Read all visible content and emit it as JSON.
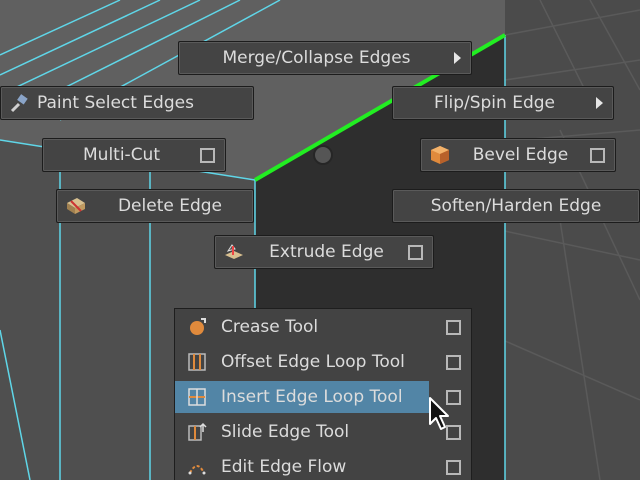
{
  "colors": {
    "viewport_bg": "#4a4a4a",
    "wire": "#5fd6e8",
    "selected_edge": "#22ee22",
    "highlight": "#5285a6"
  },
  "marking_menu": {
    "merge_collapse": {
      "label": "Merge/Collapse Edges",
      "submenu_arrow": true
    },
    "paint_select": {
      "label": "Paint Select Edges",
      "icon": "paint-select-icon"
    },
    "flip_spin": {
      "label": "Flip/Spin Edge",
      "submenu_arrow": true
    },
    "multi_cut": {
      "label": "Multi-Cut",
      "option_box": true
    },
    "bevel": {
      "label": "Bevel Edge",
      "icon": "bevel-icon",
      "option_box": true
    },
    "delete_edge": {
      "label": "Delete Edge",
      "icon": "delete-edge-icon"
    },
    "soften_harden": {
      "label": "Soften/Harden Edge"
    },
    "extrude": {
      "label": "Extrude Edge",
      "icon": "extrude-icon",
      "option_box": true
    }
  },
  "submenu": {
    "items": [
      {
        "label": "Crease Tool",
        "icon": "crease-icon"
      },
      {
        "label": "Offset Edge Loop Tool",
        "icon": "offset-edge-loop-icon"
      },
      {
        "label": "Insert Edge Loop Tool",
        "icon": "insert-edge-loop-icon",
        "highlighted": true
      },
      {
        "label": "Slide Edge Tool",
        "icon": "slide-edge-icon"
      },
      {
        "label": "Edit Edge Flow",
        "icon": "edit-edge-flow-icon"
      }
    ]
  }
}
